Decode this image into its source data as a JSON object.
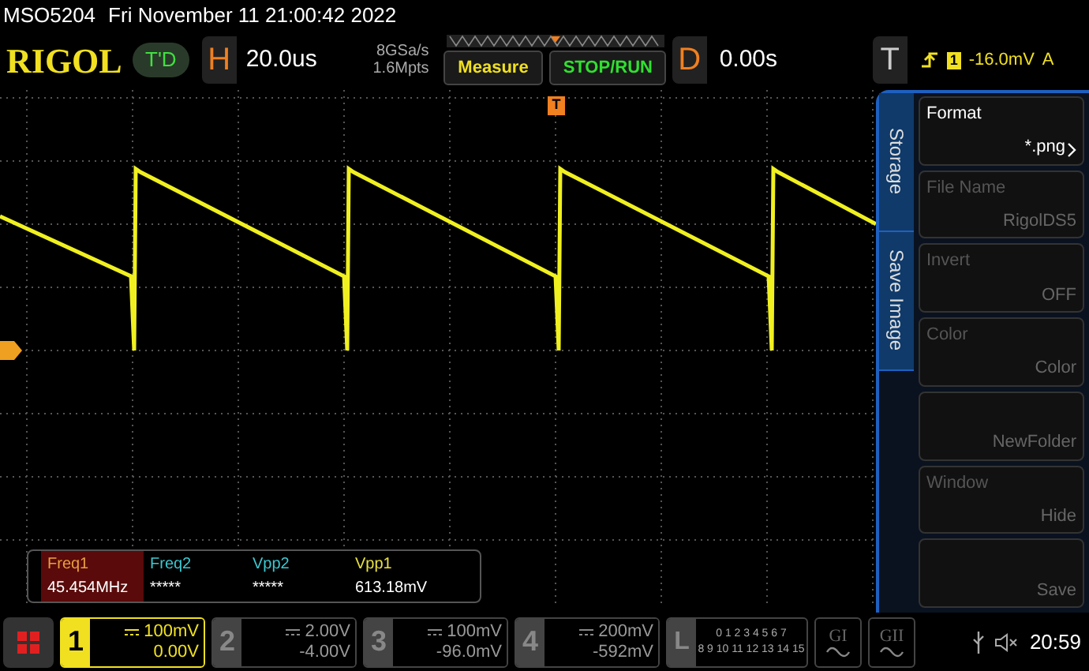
{
  "status_line": {
    "model": "MSO5204",
    "datetime": "Fri November 11 21:00:42 2022"
  },
  "toolbar": {
    "logo": "RIGOL",
    "mode_badge": "T'D",
    "horizontal": {
      "label": "H",
      "timebase": "20.0us",
      "sample_rate": "8GSa/s",
      "memory_depth": "1.6Mpts"
    },
    "buttons": [
      "Measure",
      "STOP/RUN"
    ],
    "delay": {
      "label": "D",
      "value": "0.00s"
    },
    "trigger": {
      "label": "T",
      "source": "1",
      "level": "-16.0mV",
      "mode": "A"
    }
  },
  "screen": {
    "trigger_marker": "T"
  },
  "measurements": [
    {
      "label": "Freq1",
      "value": "45.454MHz",
      "color": "#e8a040",
      "selected": true
    },
    {
      "label": "Freq2",
      "value": "*****",
      "color": "#3cc8d0",
      "selected": false
    },
    {
      "label": "Vpp2",
      "value": "*****",
      "color": "#3cc8d0",
      "selected": false
    },
    {
      "label": "Vpp1",
      "value": "613.18mV",
      "color": "#e8e040",
      "selected": false
    }
  ],
  "side_menu": {
    "tabs": [
      "Storage",
      "Save Image"
    ],
    "items": [
      {
        "label": "Format",
        "value": "*.png",
        "disabled": false,
        "submenu": true
      },
      {
        "label": "File Name",
        "value": "RigolDS5",
        "disabled": true,
        "submenu": false
      },
      {
        "label": "Invert",
        "value": "OFF",
        "disabled": true,
        "submenu": false
      },
      {
        "label": "Color",
        "value": "Color",
        "disabled": true,
        "submenu": false
      },
      {
        "value": "NewFolder",
        "disabled": true,
        "submenu": false
      },
      {
        "label": "Window",
        "value": "Hide",
        "disabled": true,
        "submenu": false
      },
      {
        "value": "Save",
        "disabled": true,
        "submenu": false
      }
    ]
  },
  "channels": [
    {
      "number": "1",
      "scale": "100mV",
      "offset": "0.00V",
      "active": true
    },
    {
      "number": "2",
      "scale": "2.00V",
      "offset": "-4.00V",
      "active": false
    },
    {
      "number": "3",
      "scale": "100mV",
      "offset": "-96.0mV",
      "active": false
    },
    {
      "number": "4",
      "scale": "200mV",
      "offset": "-592mV",
      "active": false
    }
  ],
  "logic": {
    "label": "L",
    "row_1": "0 1 2 3 4 5 6 7",
    "row_2": "8 9 10 11 12 13 14 15"
  },
  "generators": [
    "GI",
    "GII"
  ],
  "clock": "20:59"
}
